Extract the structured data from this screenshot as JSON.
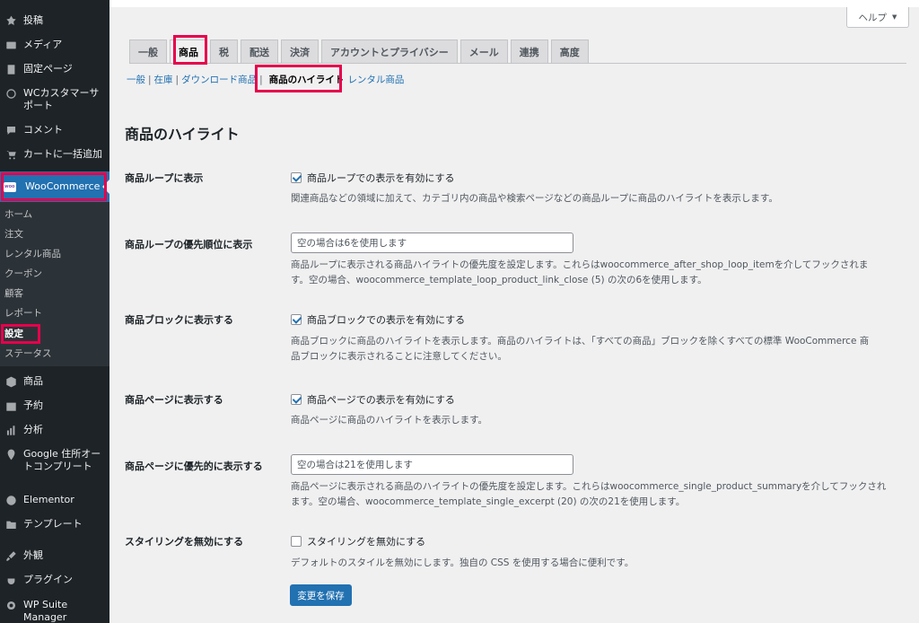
{
  "sidebar": {
    "items": [
      {
        "label": "投稿",
        "icon": "pin-icon"
      },
      {
        "label": "メディア",
        "icon": "media-icon"
      },
      {
        "label": "固定ページ",
        "icon": "pages-icon"
      },
      {
        "label": "WCカスタマーサ\nポート",
        "icon": "support-icon"
      },
      {
        "label": "コメント",
        "icon": "comment-icon"
      },
      {
        "label": "カートに一括追加",
        "icon": "cart-icon"
      },
      {
        "label": "WooCommerce",
        "icon": "woo-icon"
      },
      {
        "label": "商品",
        "icon": "product-icon"
      },
      {
        "label": "予約",
        "icon": "calendar-icon"
      },
      {
        "label": "分析",
        "icon": "analytics-icon"
      },
      {
        "label": "Google 住所オー\nトコンプリート",
        "icon": "location-icon"
      },
      {
        "label": "Elementor",
        "icon": "elementor-icon"
      },
      {
        "label": "テンプレート",
        "icon": "folder-icon"
      },
      {
        "label": "外観",
        "icon": "brush-icon"
      },
      {
        "label": "プラグイン",
        "icon": "plugin-icon"
      },
      {
        "label": "WP Suite\nManager",
        "icon": "gear-icon"
      }
    ],
    "submenu": [
      "ホーム",
      "注文",
      "レンタル商品",
      "クーポン",
      "顧客",
      "レポート",
      "設定",
      "ステータス"
    ]
  },
  "help": {
    "label": "ヘルプ",
    "arrow": "▼"
  },
  "tabs": [
    "一般",
    "商品",
    "税",
    "配送",
    "決済",
    "アカウントとプライバシー",
    "メール",
    "連携",
    "高度"
  ],
  "subsections": [
    "一般",
    "在庫",
    "ダウンロード商品",
    "商品のハイライト",
    "レンタル商品"
  ],
  "page_title": "商品のハイライト",
  "fields": {
    "loop": {
      "label": "商品ループに表示",
      "checkbox": "商品ループでの表示を有効にする",
      "checked": true,
      "desc": "関連商品などの領域に加えて、カテゴリ内の商品や検索ページなどの商品ループに商品のハイライトを表示します。"
    },
    "loop_priority": {
      "label": "商品ループの優先順位に表示",
      "placeholder": "空の場合は6を使用します",
      "desc1": "商品ループに表示される商品ハイライトの優先度を設定します。これらはwoocommerce_after_shop_loop_itemを介してフックされま",
      "desc2": "す。空の場合、woocommerce_template_loop_product_link_close (5) の次の6を使用します。"
    },
    "block": {
      "label": "商品ブロックに表示する",
      "checkbox": "商品ブロックでの表示を有効にする",
      "checked": true,
      "desc1": "商品ブロックに商品のハイライトを表示します。商品のハイライトは、「すべての商品」ブロックを除くすべての標準 WooCommerce 商",
      "desc2": "品ブロックに表示されることに注意してください。"
    },
    "page": {
      "label": "商品ページに表示する",
      "checkbox": "商品ページでの表示を有効にする",
      "checked": true,
      "desc": "商品ページに商品のハイライトを表示します。"
    },
    "page_priority": {
      "label": "商品ページに優先的に表示する",
      "placeholder": "空の場合は21を使用します",
      "desc1": "商品ページに表示される商品のハイライトの優先度を設定します。これらはwoocommerce_single_product_summaryを介してフックされ",
      "desc2": "ます。空の場合、woocommerce_template_single_excerpt (20) の次の21を使用します。"
    },
    "styling": {
      "label": "スタイリングを無効にする",
      "checkbox": "スタイリングを無効にする",
      "checked": false,
      "desc": "デフォルトのスタイルを無効にします。独自の CSS を使用する場合に便利です。"
    }
  },
  "save_label": "変更を保存",
  "colors": {
    "accent": "#2271b1",
    "highlight": "#e6004c",
    "sidebar": "#1d2327"
  }
}
